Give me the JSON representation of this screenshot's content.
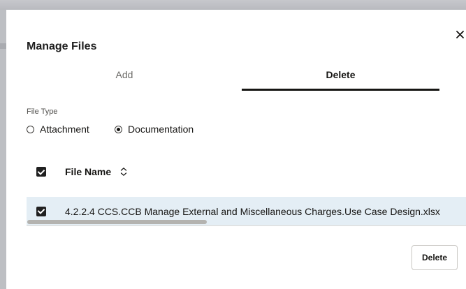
{
  "dialog": {
    "title": "Manage Files",
    "close_icon": "close-icon"
  },
  "tabs": [
    {
      "label": "Add",
      "selected": false
    },
    {
      "label": "Delete",
      "selected": true
    }
  ],
  "file_type": {
    "label": "File Type",
    "options": [
      {
        "label": "Attachment",
        "selected": false
      },
      {
        "label": "Documentation",
        "selected": true
      }
    ]
  },
  "table": {
    "select_all_checked": true,
    "column_header": "File Name",
    "sort_icon": "sort-icon",
    "rows": [
      {
        "checked": true,
        "file_name": "4.2.2.4 CCS.CCB Manage External and Miscellaneous Charges.Use Case Design.xlsx"
      }
    ]
  },
  "footer": {
    "delete_label": "Delete"
  },
  "colors": {
    "selected_row_bg": "#e4eef5",
    "tab_underline": "#161513",
    "backdrop": "#bdbfc3"
  }
}
